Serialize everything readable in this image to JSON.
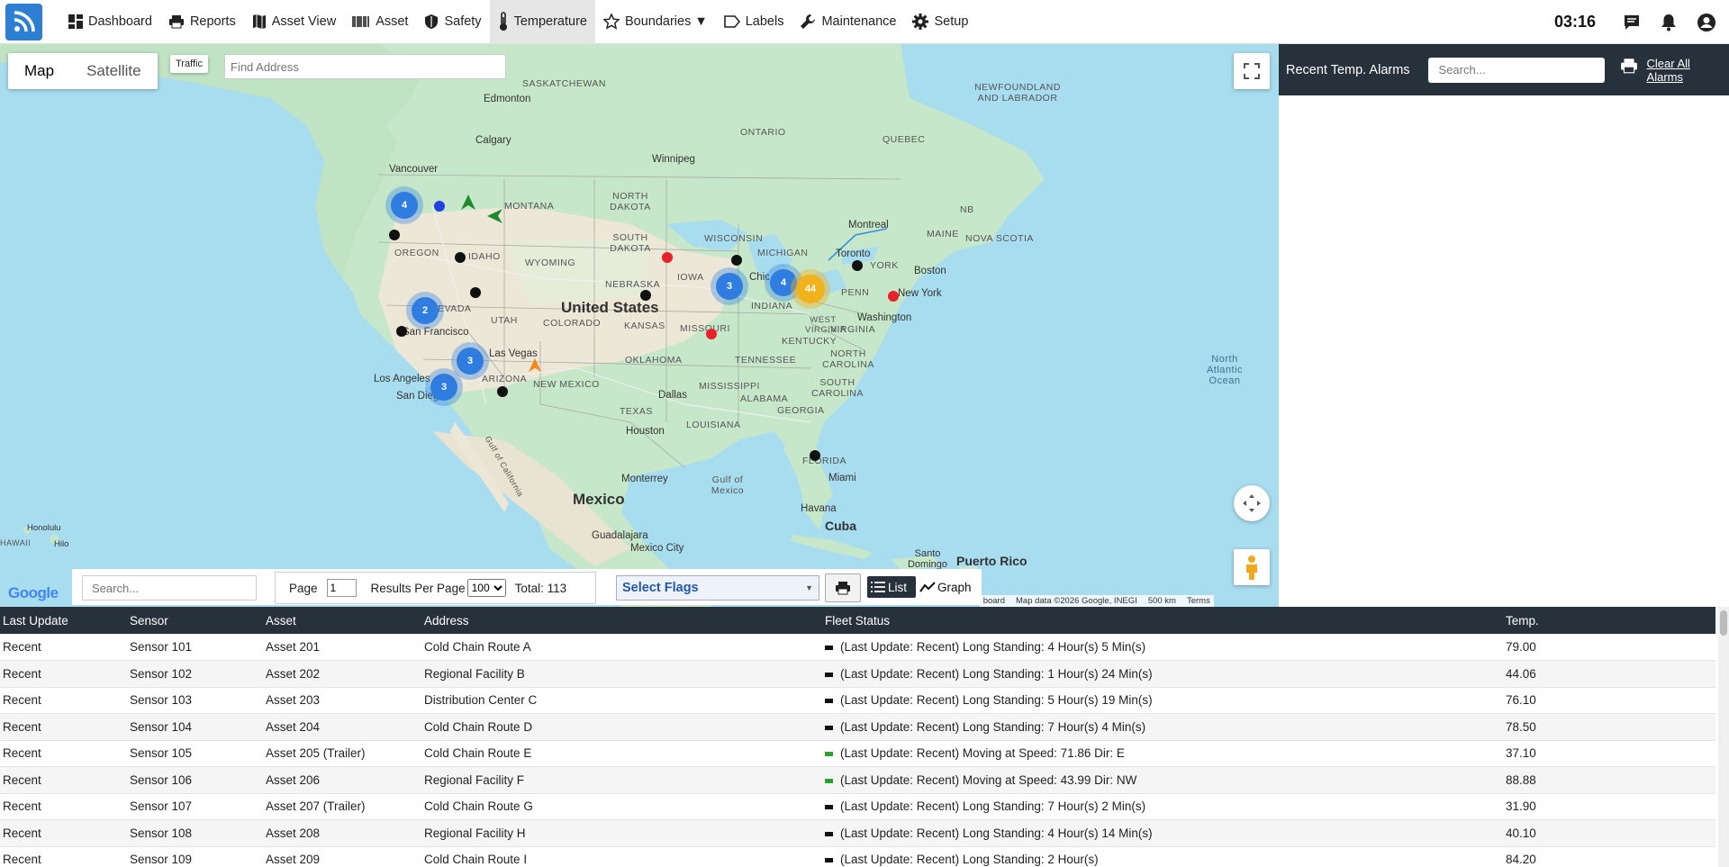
{
  "nav": {
    "items": [
      {
        "label": "Dashboard",
        "icon": "dashboard-icon"
      },
      {
        "label": "Reports",
        "icon": "printer-icon"
      },
      {
        "label": "Asset View",
        "icon": "map-icon"
      },
      {
        "label": "Asset",
        "icon": "barcode-icon"
      },
      {
        "label": "Safety",
        "icon": "shield-icon"
      },
      {
        "label": "Temperature",
        "icon": "thermometer-icon",
        "active": true
      },
      {
        "label": "Boundaries ▼",
        "icon": "star-icon"
      },
      {
        "label": "Labels",
        "icon": "tag-icon"
      },
      {
        "label": "Maintenance",
        "icon": "wrench-icon"
      },
      {
        "label": "Setup",
        "icon": "gear-icon"
      }
    ],
    "clock": "03:16",
    "accent": "#2d7fd3"
  },
  "map": {
    "type_options": [
      "Map",
      "Satellite"
    ],
    "selected_type": "Map",
    "traffic_label": "Traffic",
    "find_address_placeholder": "Find Address",
    "region_labels": [
      "SASKATCHEWAN",
      "NEWFOUNDLAND AND LABRADOR",
      "ONTARIO",
      "QUEBEC",
      "NORTH DAKOTA",
      "MONTANA",
      "SOUTH DAKOTA",
      "WISCONSIN",
      "MICHIGAN",
      "MAINE",
      "NOVA SCOTIA",
      "OREGON",
      "IDAHO",
      "WYOMING",
      "IOWA",
      "NEBRASKA",
      "PENN",
      "NEVADA",
      "UTAH",
      "COLORADO",
      "KANSAS",
      "MISSOURI",
      "INDIANA",
      "VIRGINIA",
      "WEST VIRGINIA",
      "KENTUCKY",
      "OKLAHOMA",
      "TENNESSEE",
      "NORTH CAROLINA",
      "ARIZONA",
      "NEW MEXICO",
      "SOUTH CAROLINA",
      "MISSISSIPPI",
      "ALABAMA",
      "GEORGIA",
      "TEXAS",
      "LOUISIANA",
      "FLORIDA",
      "NB",
      "YORK",
      "Gulf of Mexico",
      "Gulf of California",
      "North Atlantic Ocean",
      "HAWAII"
    ],
    "city_labels": [
      "Edmonton",
      "Calgary",
      "Vancouver",
      "Winnipeg",
      "Montreal",
      "Toronto",
      "Boston",
      "New York",
      "Washington",
      "Chicago",
      "Las Vegas",
      "Los Angeles",
      "San Diego",
      "San Francisco",
      "Dallas",
      "Houston",
      "Monterrey",
      "Miami",
      "Havana",
      "Guadalajara",
      "Mexico City",
      "Santo Domingo",
      "Honolulu",
      "Hilo"
    ],
    "country_labels": [
      "United States",
      "Mexico",
      "Cuba",
      "Puerto Rico"
    ],
    "clusters": [
      "4",
      "2",
      "3",
      "3",
      "3",
      "4",
      "44"
    ],
    "attribution": [
      "Keyboard shortcuts",
      "Map data ©2026 Google, INEGI",
      "500 km",
      "Terms"
    ],
    "logo_text": "Google"
  },
  "toolbar": {
    "search_placeholder": "Search...",
    "page_label": "Page",
    "page_value": "1",
    "results_label": "Results Per Page",
    "results_value": "100",
    "total_label": "Total: 113",
    "flags_label": "Select Flags",
    "list_label": "List",
    "graph_label": "Graph"
  },
  "alarms": {
    "title": "Recent Temp. Alarms",
    "search_placeholder": "Search...",
    "clear_label": "Clear All Alarms"
  },
  "table": {
    "headers": [
      "Last Update",
      "Sensor",
      "Asset",
      "Address",
      "Fleet Status",
      "Temp."
    ],
    "rows": [
      [
        "Recent",
        "Sensor 101",
        "Asset 201",
        "Cold Chain Route A",
        "(Last Update: Recent) Long Standing: 4 Hour(s) 5 Min(s)",
        "79.00",
        "#111111"
      ],
      [
        "Recent",
        "Sensor 102",
        "Asset 202",
        "Regional Facility B",
        "(Last Update: Recent) Long Standing: 1 Hour(s) 24 Min(s)",
        "44.06",
        "#111111"
      ],
      [
        "Recent",
        "Sensor 103",
        "Asset 203",
        "Distribution Center C",
        "(Last Update: Recent) Long Standing: 5 Hour(s) 19 Min(s)",
        "76.10",
        "#111111"
      ],
      [
        "Recent",
        "Sensor 104",
        "Asset 204",
        "Cold Chain Route D",
        "(Last Update: Recent) Long Standing: 7 Hour(s) 4 Min(s)",
        "78.50",
        "#111111"
      ],
      [
        "Recent",
        "Sensor 105",
        "Asset 205 (Trailer)",
        "Cold Chain Route E",
        "(Last Update: Recent) Moving at Speed: 71.86 Dir: E",
        "37.10",
        "#2ca02c"
      ],
      [
        "Recent",
        "Sensor 106",
        "Asset 206",
        "Regional Facility F",
        "(Last Update: Recent) Moving at Speed: 43.99 Dir: NW",
        "88.88",
        "#2ca02c"
      ],
      [
        "Recent",
        "Sensor 107",
        "Asset 207 (Trailer)",
        "Cold Chain Route G",
        "(Last Update: Recent) Long Standing: 7 Hour(s) 2 Min(s)",
        "31.90",
        "#111111"
      ],
      [
        "Recent",
        "Sensor 108",
        "Asset 208",
        "Regional Facility H",
        "(Last Update: Recent) Long Standing: 4 Hour(s) 14 Min(s)",
        "40.10",
        "#111111"
      ],
      [
        "Recent",
        "Sensor 109",
        "Asset 209",
        "Cold Chain Route I",
        "(Last Update: Recent) Long Standing: 2 Hour(s)",
        "84.20",
        "#111111"
      ]
    ]
  },
  "colors": {
    "header_dark": "#27313c",
    "water": "#a8dcef",
    "land": "#c9e8cc",
    "cluster_blue": "#2f7de1",
    "cluster_orange": "#f2b21b",
    "alarm_red": "#e8202a"
  }
}
